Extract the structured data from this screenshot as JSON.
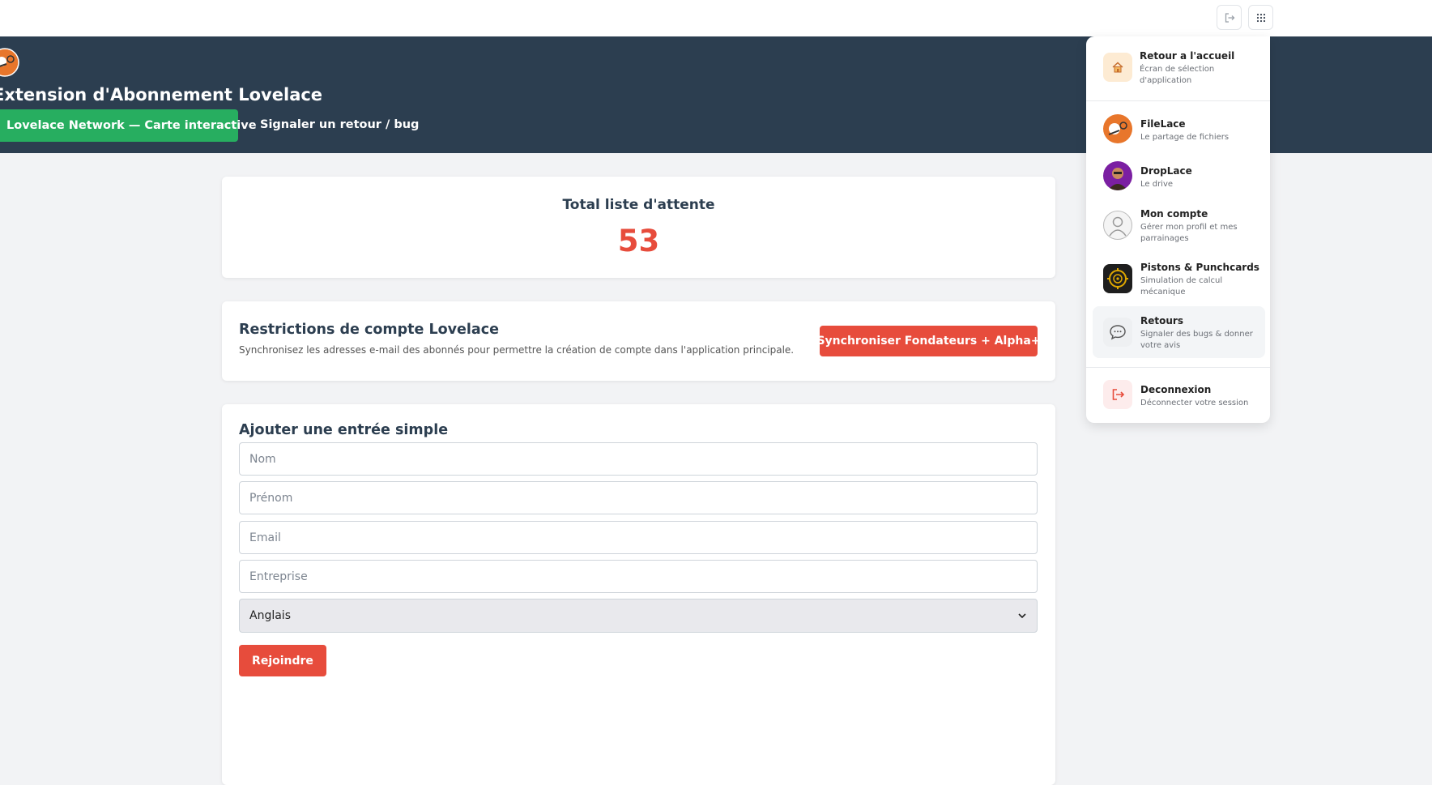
{
  "topbar": {
    "logout_icon": "logout-icon",
    "apps_icon": "apps-grid-icon"
  },
  "header": {
    "title": "Extension d'Abonnement Lovelace",
    "map_button": "Lovelace Network — Carte interactive",
    "feedback_link": "Signaler un retour / bug"
  },
  "waitlist": {
    "label": "Total liste d'attente",
    "count": "53"
  },
  "restrictions": {
    "title": "Restrictions de compte Lovelace",
    "description": "Synchronisez les adresses e-mail des abonnés pour permettre la création de compte dans l'application principale.",
    "sync_button": "Synchroniser Fondateurs + Alpha+"
  },
  "form": {
    "title": "Ajouter une entrée simple",
    "nom_placeholder": "Nom",
    "prenom_placeholder": "Prénom",
    "email_placeholder": "Email",
    "entreprise_placeholder": "Entreprise",
    "language_selected": "Anglais",
    "submit_label": "Rejoindre"
  },
  "menu": {
    "items": [
      {
        "title": "Retour a l'accueil",
        "subtitle": "Écran de sélection d'application",
        "icon": "home-icon"
      },
      {
        "title": "FileLace",
        "subtitle": "Le partage de fichiers",
        "icon": "filelace-logo-icon"
      },
      {
        "title": "DropLace",
        "subtitle": "Le drive",
        "icon": "droplace-avatar-icon"
      },
      {
        "title": "Mon compte",
        "subtitle": "Gérer mon profil et mes parrainages",
        "icon": "user-icon"
      },
      {
        "title": "Pistons & Punchcards",
        "subtitle": "Simulation de calcul mécanique",
        "icon": "gear-icon"
      },
      {
        "title": "Retours",
        "subtitle": "Signaler des bugs & donner votre avis",
        "icon": "chat-bubble-icon"
      },
      {
        "title": "Deconnexion",
        "subtitle": "Déconnecter votre session",
        "icon": "logout-icon"
      }
    ]
  },
  "colors": {
    "header_bg": "#2c3e50",
    "accent_green": "#27ae60",
    "accent_red": "#e74c3c",
    "page_bg": "#f2f3f5"
  }
}
